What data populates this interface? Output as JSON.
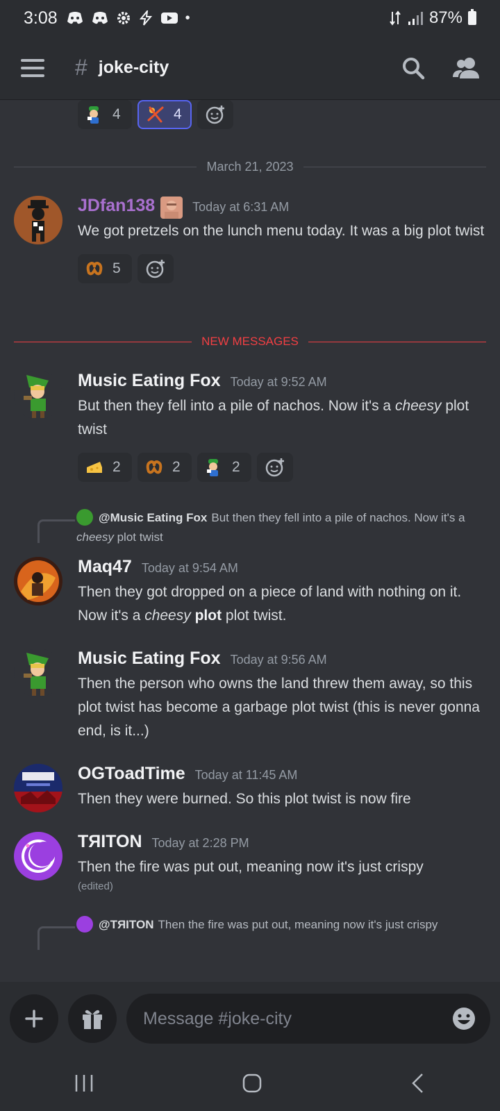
{
  "status_bar": {
    "time": "3:08",
    "battery": "87%"
  },
  "header": {
    "hash": "#",
    "channel_name": "joke-city"
  },
  "top_reactions": [
    {
      "count": "4",
      "active": false
    },
    {
      "count": "4",
      "active": true
    }
  ],
  "date_divider": "March 21, 2023",
  "new_messages_divider": "NEW MESSAGES",
  "messages": [
    {
      "username": "JDfan138",
      "username_color": "#a970cf",
      "timestamp": "Today at 6:31 AM",
      "text": "We got pretzels on the lunch menu today. It was a big plot twist",
      "reactions": [
        {
          "emoji": "pretzel",
          "count": "5"
        }
      ]
    },
    {
      "username": "Music Eating Fox",
      "timestamp": "Today at 9:52 AM",
      "text_before": "But then they fell into a pile of nachos. Now it's a ",
      "text_em": "cheesy",
      "text_after": " plot twist",
      "reactions": [
        {
          "emoji": "cheese",
          "count": "2"
        },
        {
          "emoji": "pretzel",
          "count": "2"
        },
        {
          "emoji": "luigi",
          "count": "2"
        }
      ]
    },
    {
      "reply": {
        "name": "@Music Eating Fox",
        "text_before": "But then they fell into a pile of nachos. Now it's a ",
        "text_em": "cheesy",
        "text_after": " plot twist"
      },
      "username": "Maq47",
      "timestamp": "Today at 9:54 AM",
      "text_before": "Then they got dropped on a piece of land with nothing on it. Now it's a ",
      "text_em": "cheesy",
      "text_bold": "plot",
      "text_after": " plot twist."
    },
    {
      "username": "Music Eating Fox",
      "timestamp": "Today at 9:56 AM",
      "text": "Then the person who owns the land threw them away, so this plot twist has become a garbage plot twist (this is never gonna end, is it...)"
    },
    {
      "username": "OGToadTime",
      "timestamp": "Today at 11:45 AM",
      "text": "Then they were burned. So this plot twist is now fire"
    },
    {
      "username": "TЯITON",
      "timestamp": "Today at 2:28 PM",
      "text": "Then the fire was put out, meaning now it's just crispy",
      "edited": "(edited)"
    }
  ],
  "bottom_reply": {
    "name": "@TЯITON",
    "text": "Then the fire was put out, meaning now it's just crispy"
  },
  "composer": {
    "placeholder": "Message #joke-city"
  },
  "colors": {
    "accent": "#5865f2",
    "new_messages": "#f23f43",
    "background": "#313338"
  }
}
